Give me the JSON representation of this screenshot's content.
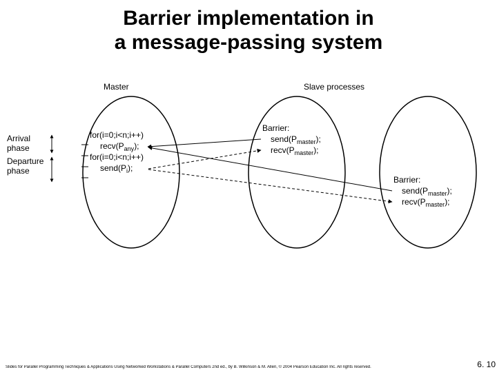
{
  "title_line1": "Barrier implementation in",
  "title_line2": "a message-passing system",
  "labels": {
    "master": "Master",
    "slaves": "Slave processes",
    "arrival": "Arrival",
    "phase1": "phase",
    "departure": "Departure",
    "phase2": "phase"
  },
  "master_code": {
    "l1a": "for(i=0;i<n;i++)",
    "l2a": "recv(P",
    "l2b": "any",
    "l2c": ");",
    "l3a": "for(i=0;i<n;i++)",
    "l4a": "send(P",
    "l4b": "i",
    "l4c": ");"
  },
  "slave_code": {
    "barrier": "Barrier:",
    "s1a": "send(P",
    "s1b": "master",
    "s1c": ");",
    "r1a": "recv(P",
    "r1b": "master",
    "r1c": ");"
  },
  "footer": "Slides for Parallel Programming Techniques & Applications Using Networked Workstations & Parallel Computers 2nd ed., by B. Wilkinson & M. Allen, © 2004 Pearson Education Inc. All rights reserved.",
  "page": "6. 10"
}
